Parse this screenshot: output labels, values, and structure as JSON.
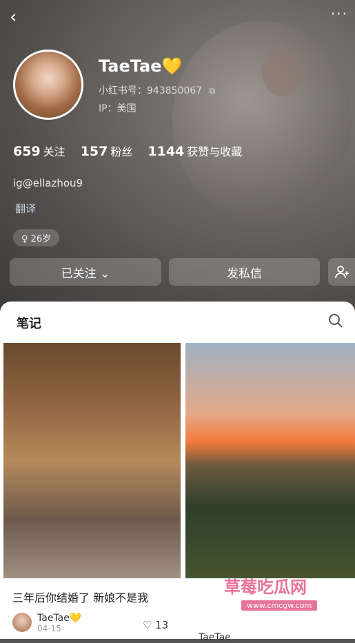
{
  "profile": {
    "name": "TaeTae",
    "name_emoji": "💛",
    "id_label": "小红书号：943850067",
    "ip_label": "IP：美国",
    "stats": [
      {
        "value": "659",
        "label": "关注"
      },
      {
        "value": "157",
        "label": "粉丝"
      },
      {
        "value": "1144",
        "label": "获赞与收藏"
      }
    ],
    "bio": "ig@ellazhou9",
    "translate": "翻译",
    "tag": "♀ 26岁"
  },
  "actions": {
    "follow": "已关注 ⌄",
    "message": "发私信"
  },
  "notes": {
    "title": "笔记",
    "cards": [
      {
        "caption": "三年后你结婚了 新娘不是我",
        "author": "TaeTae💛",
        "date": "04-15",
        "likes": "13"
      },
      {
        "author": "TaeTae"
      }
    ]
  },
  "watermark": {
    "main": "草莓吃瓜网",
    "sub": "www.cmcgw.com"
  }
}
